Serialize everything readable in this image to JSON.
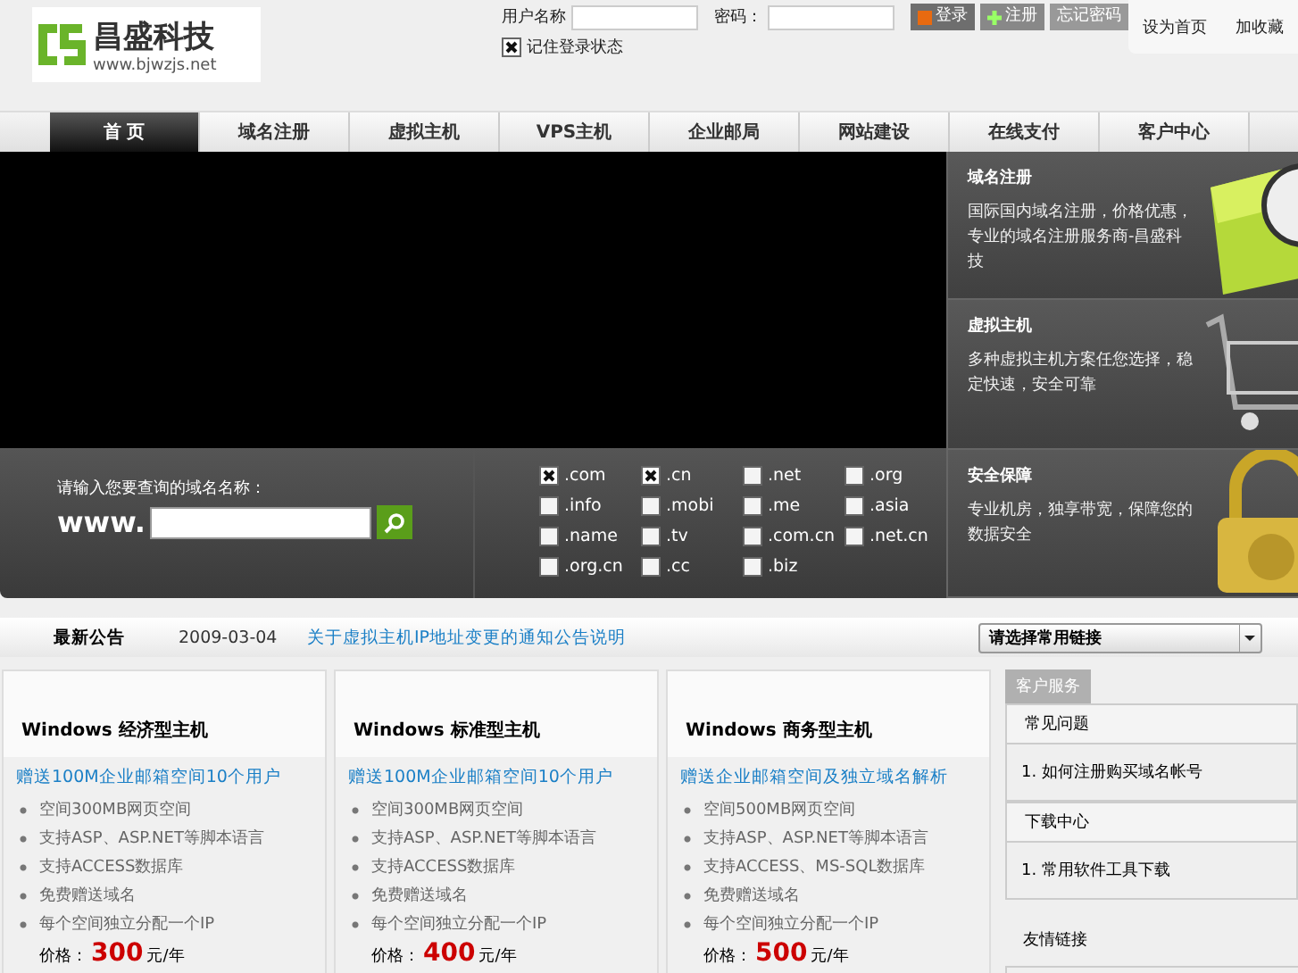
{
  "logo": {
    "name": "昌盛科技",
    "url": "www.bjwzjs.net"
  },
  "login": {
    "user_label": "用户名称",
    "pass_label": "密码：",
    "buttons": [
      {
        "label": "登录",
        "kind": "primary"
      },
      {
        "label": "注册",
        "kind": "plus"
      },
      {
        "label": "忘记密码",
        "kind": "plain"
      }
    ],
    "remember": {
      "label": "记住登录状态",
      "checked": true
    }
  },
  "top_links": [
    "设为首页",
    "加收藏"
  ],
  "nav": [
    {
      "label": "首 页",
      "selected": true
    },
    {
      "label": "域名注册",
      "selected": false
    },
    {
      "label": "虚拟主机",
      "selected": false
    },
    {
      "label": "VPS主机",
      "selected": false
    },
    {
      "label": "企业邮局",
      "selected": false
    },
    {
      "label": "网站建设",
      "selected": false
    },
    {
      "label": "在线支付",
      "selected": false
    },
    {
      "label": "客户中心",
      "selected": false
    }
  ],
  "promos": [
    {
      "title": "域名注册",
      "text": "国际国内域名注册，价格优惠，专业的域名注册服务商-昌盛科技",
      "kind": "box"
    },
    {
      "title": "虚拟主机",
      "text": "多种虚拟主机方案任您选择，稳定快速，安全可靠",
      "kind": "cart"
    },
    {
      "title": "安全保障",
      "text": "专业机房，独享带宽，保障您的数据安全",
      "kind": "lock"
    }
  ],
  "domain_search": {
    "label": "请输入您要查询的域名名称：",
    "prefix": "www.",
    "tlds": [
      {
        "label": ".com",
        "checked": true
      },
      {
        "label": ".cn",
        "checked": true
      },
      {
        "label": ".net",
        "checked": false
      },
      {
        "label": ".org",
        "checked": false
      },
      {
        "label": ".info",
        "checked": false
      },
      {
        "label": ".mobi",
        "checked": false
      },
      {
        "label": ".me",
        "checked": false
      },
      {
        "label": ".asia",
        "checked": false
      },
      {
        "label": ".name",
        "checked": false
      },
      {
        "label": ".tv",
        "checked": false
      },
      {
        "label": ".com.cn",
        "checked": false
      },
      {
        "label": ".net.cn",
        "checked": false
      },
      {
        "label": ".org.cn",
        "checked": false
      },
      {
        "label": ".cc",
        "checked": false
      },
      {
        "label": ".biz",
        "checked": false
      }
    ]
  },
  "news": {
    "title": "最新公告",
    "date": "2009-03-04",
    "link": "关于虚拟主机IP地址变更的通知公告说明",
    "select": "请选择常用链接"
  },
  "plans": [
    {
      "title": "Windows 经济型主机",
      "highlight": "赠送100M企业邮箱空间10个用户",
      "features": [
        "空间300MB网页空间",
        "支持ASP、ASP.NET等脚本语言",
        "支持ACCESS数据库",
        "免费赠送域名",
        "每个空间独立分配一个IP"
      ],
      "price_label": "价格：",
      "price": "300",
      "unit": "元/年"
    },
    {
      "title": "Windows 标准型主机",
      "highlight": "赠送100M企业邮箱空间10个用户",
      "features": [
        "空间300MB网页空间",
        "支持ASP、ASP.NET等脚本语言",
        "支持ACCESS数据库",
        "免费赠送域名",
        "每个空间独立分配一个IP"
      ],
      "price_label": "价格：",
      "price": "400",
      "unit": "元/年"
    },
    {
      "title": "Windows 商务型主机",
      "highlight": "赠送企业邮箱空间及独立域名解析",
      "features": [
        "空间500MB网页空间",
        "支持ASP、ASP.NET等脚本语言",
        "支持ACCESS、MS-SQL数据库",
        "免费赠送域名",
        "每个空间独立分配一个IP"
      ],
      "price_label": "价格：",
      "price": "500",
      "unit": "元/年"
    }
  ],
  "sidebar": {
    "title": "客户服务",
    "sections": [
      {
        "title": "常见问题",
        "items": [
          "1. 如何注册购买域名帐号"
        ]
      },
      {
        "title": "下载中心",
        "items": [
          "1. 常用软件工具下载"
        ]
      },
      {
        "title": "友情链接"
      }
    ]
  }
}
